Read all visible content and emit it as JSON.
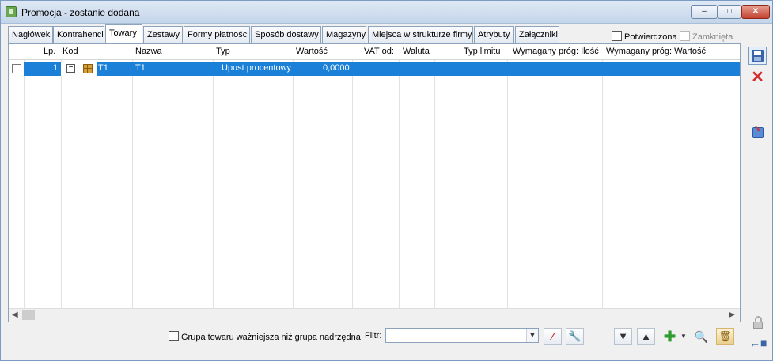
{
  "window": {
    "title": "Promocja - zostanie dodana"
  },
  "tabs": [
    {
      "label": "Nagłówek"
    },
    {
      "label": "Kontrahenci"
    },
    {
      "label": "Towary"
    },
    {
      "label": "Zestawy"
    },
    {
      "label": "Formy płatności"
    },
    {
      "label": "Sposób dostawy"
    },
    {
      "label": "Magazyny"
    },
    {
      "label": "Miejsca w strukturze firmy"
    },
    {
      "label": "Atrybuty"
    },
    {
      "label": "Załączniki"
    }
  ],
  "active_tab": "Towary",
  "status": {
    "confirmed_label": "Potwierdzona",
    "confirmed_checked": false,
    "closed_label": "Zamknięta",
    "closed_checked": false,
    "closed_disabled": true
  },
  "grid": {
    "columns": [
      "Lp.",
      "Kod",
      "Nazwa",
      "Typ",
      "Wartość",
      "VAT od:",
      "Waluta",
      "Typ limitu",
      "Wymagany próg: Ilość",
      "Wymagany próg: Wartość"
    ],
    "rows": [
      {
        "lp": "1",
        "kod": "T1",
        "nazwa": "T1",
        "typ": "Upust procentowy",
        "wartosc": "0,0000",
        "vat_od": "",
        "waluta": "",
        "typ_limitu": "",
        "prog_ilosc": "",
        "prog_wartosc": "",
        "selected": true
      }
    ]
  },
  "bottom": {
    "group_checkbox_label": "Grupa towaru ważniejsza niż grupa nadrzędna",
    "group_checkbox_checked": false,
    "filter_label": "Filtr:",
    "filter_value": ""
  },
  "icons": {
    "app": "promotion-icon",
    "save": "floppy-disk-icon",
    "cancel": "red-x-icon",
    "import": "import-icon",
    "lock": "padlock-icon",
    "pin": "pin-icon",
    "clear_filter": "clear-filter-icon",
    "filter_wizard": "filter-wizard-icon",
    "move_down": "move-down-icon",
    "move_up": "move-up-icon",
    "add": "plus-icon",
    "zoom": "magnifier-icon",
    "delete": "trash-icon"
  },
  "colors": {
    "selection": "#1a80d8",
    "accent": "#3b63a8",
    "cancel": "#d32f2f",
    "add": "#2e9b2e"
  }
}
